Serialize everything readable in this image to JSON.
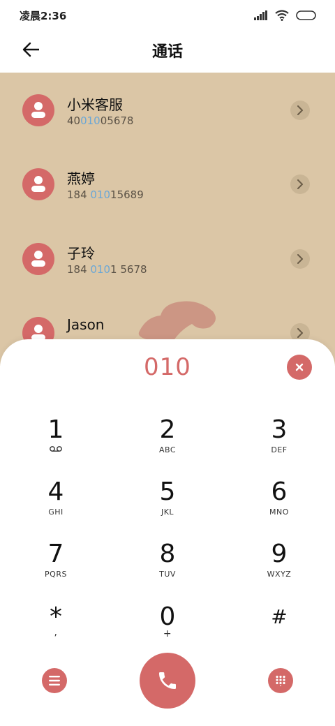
{
  "status": {
    "time": "凌晨2:36"
  },
  "header": {
    "title": "通话"
  },
  "contacts": [
    {
      "name": "小米客服",
      "num_pre": "40",
      "num_hl": "010",
      "num_post": "05678"
    },
    {
      "name": "燕婷",
      "num_pre": "184 ",
      "num_hl": "010",
      "num_post": "15689"
    },
    {
      "name": "子玲",
      "num_pre": "184 ",
      "num_hl": "010",
      "num_post": "1 5678"
    },
    {
      "name": "Jason",
      "num_pre": "",
      "num_hl": "",
      "num_post": ""
    }
  ],
  "dialpad": {
    "entered": "010",
    "keys": [
      {
        "digit": "1",
        "letters": ""
      },
      {
        "digit": "2",
        "letters": "ABC"
      },
      {
        "digit": "3",
        "letters": "DEF"
      },
      {
        "digit": "4",
        "letters": "GHI"
      },
      {
        "digit": "5",
        "letters": "JKL"
      },
      {
        "digit": "6",
        "letters": "MNO"
      },
      {
        "digit": "7",
        "letters": "PQRS"
      },
      {
        "digit": "8",
        "letters": "TUV"
      },
      {
        "digit": "9",
        "letters": "WXYZ"
      },
      {
        "digit": "*",
        "letters": ","
      },
      {
        "digit": "0",
        "letters": "+"
      },
      {
        "digit": "#",
        "letters": ""
      }
    ]
  },
  "icons": {
    "back": "arrow-left-icon",
    "signal": "signal-icon",
    "wifi": "wifi-icon",
    "battery": "battery-icon",
    "person": "person-icon",
    "chevron": "chevron-right-icon",
    "voicemail": "voicemail-icon",
    "clear": "close-icon",
    "menu": "menu-icon",
    "call": "phone-icon",
    "keypad": "keypad-icon"
  },
  "colors": {
    "accent": "#d46968",
    "list_bg": "#dbc6a6",
    "highlight": "#6aa7d6"
  }
}
